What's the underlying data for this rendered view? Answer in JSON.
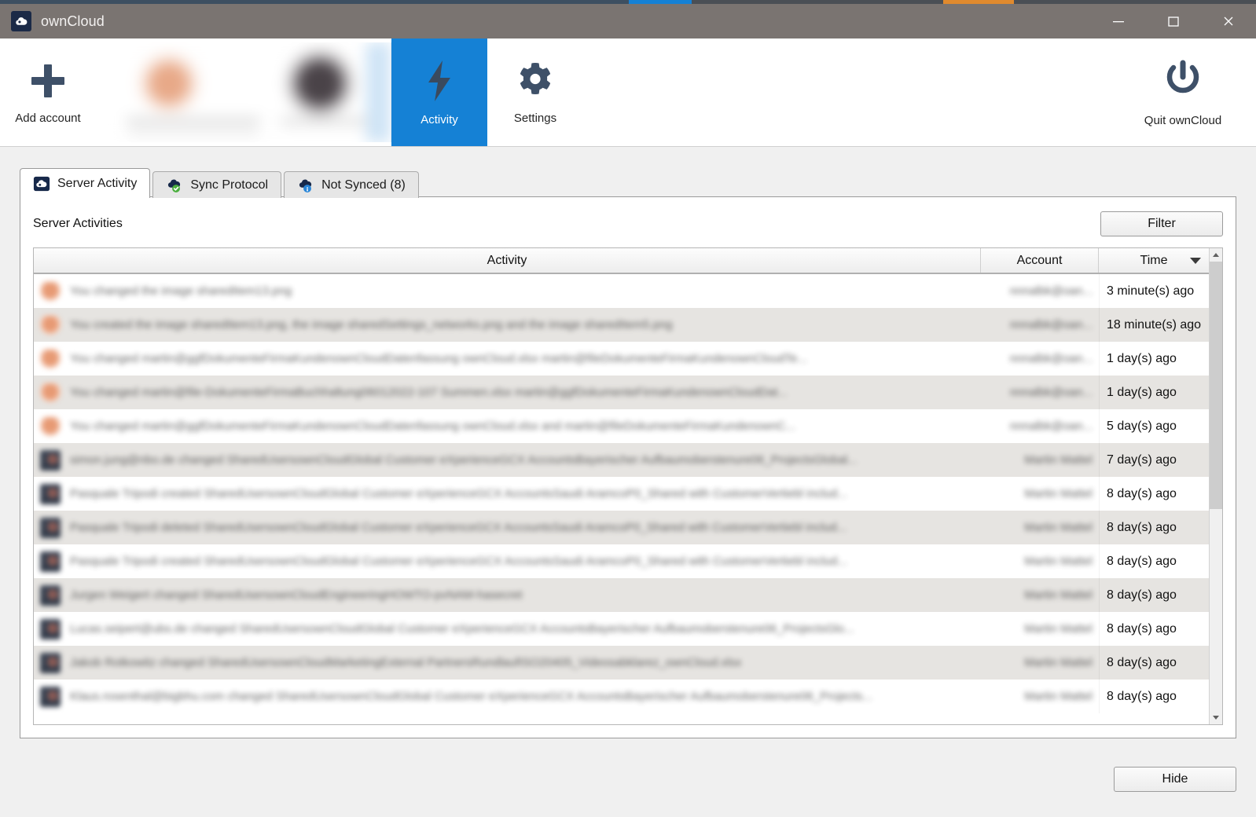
{
  "window": {
    "title": "ownCloud",
    "logo_icon": "owncloud-cloud-icon",
    "minimize_label": "Minimize",
    "maximize_label": "Maximize",
    "close_label": "Close"
  },
  "toolbar": {
    "add_account": {
      "label": "Add account",
      "icon": "plus-icon"
    },
    "accounts_strip": {
      "label": "",
      "redacted": true
    },
    "activity": {
      "label": "Activity",
      "icon": "lightning-bolt-icon",
      "active": true
    },
    "settings": {
      "label": "Settings",
      "icon": "gear-icon",
      "active": false
    },
    "quit": {
      "label": "Quit ownCloud",
      "icon": "power-icon"
    }
  },
  "tabs": [
    {
      "label": "Server Activity",
      "icon": "cloud-icon",
      "selected": true
    },
    {
      "label": "Sync Protocol",
      "icon": "cloud-check-icon",
      "selected": false
    },
    {
      "label": "Not Synced (8)",
      "icon": "cloud-info-icon",
      "selected": false
    }
  ],
  "panel": {
    "title": "Server Activities",
    "filter_button": "Filter"
  },
  "table": {
    "columns": [
      "Activity",
      "Account",
      "Time"
    ],
    "sort_column": "Time",
    "sort_icon": "sort-descending-caret",
    "rows": [
      {
        "icon": "activity-image-icon",
        "activity": "You changed the image sharedItem13.png",
        "account": "nnnalbk@oan...",
        "time": "3 minute(s) ago"
      },
      {
        "icon": "activity-image-icon",
        "activity": "You created the image sharedItem13.png, the image sharedSettings_networks.png and the image sharedItem5.png",
        "account": "nnnalbk@oan...",
        "time": "18 minute(s) ago"
      },
      {
        "icon": "activity-image-icon",
        "activity": "You changed martin@ggfDokumenteFirmaKundenownCloudDatenfassung ownCloud.xlsx martin@fileDokumenteFirmaKundenownCloudTe...",
        "account": "nnnalbk@oan...",
        "time": "1 day(s) ago"
      },
      {
        "icon": "activity-image-icon",
        "activity": "You changed martin@file-DokumenteFirmaBuchhaltung06012022-107 Summen.xlsx martin@ggfDokumenteFirmaKundenownCloudDat...",
        "account": "nnnalbk@oan...",
        "time": "1 day(s) ago"
      },
      {
        "icon": "activity-image-icon",
        "activity": "You changed martin@ggfDokumenteFirmaKundenownCloudDatenfassung ownCloud.xlsx and martin@fileDokumenteFirmaKundenownC...",
        "account": "nnnalbk@oan...",
        "time": "5 day(s) ago"
      },
      {
        "icon": "activity-folder-icon",
        "activity": "simon.jung@nbo.de changed SharedUsersownCloudGlobal Customer eXperienceGCX AccountsBayerischer Aufbaumoberstenure06_ProjectsGlobal...",
        "account": "Martin Mattel",
        "time": "7 day(s) ago"
      },
      {
        "icon": "activity-folder-icon",
        "activity": "Pasquale Tripodi created SharedUsersownCloudGlobal Customer eXperienceGCX AccountsSaudi AramcoP0_Shared with CustomerVertiebl includ...",
        "account": "Martin Mattel",
        "time": "8 day(s) ago"
      },
      {
        "icon": "activity-folder-icon",
        "activity": "Pasquale Tripodi deleted SharedUsersownCloudGlobal Customer eXperienceGCX AccountsSaudi AramcoP0_Shared with CustomerVertiebl includ...",
        "account": "Martin Mattel",
        "time": "8 day(s) ago"
      },
      {
        "icon": "activity-folder-icon",
        "activity": "Pasquale Tripodi created SharedUsersownCloudGlobal Customer eXperienceGCX AccountsSaudi AramcoP0_Shared with CustomerVertiebl includ...",
        "account": "Martin Mattel",
        "time": "8 day(s) ago"
      },
      {
        "icon": "activity-folder-icon",
        "activity": "Jurgen Weigert changed SharedUsersownCloudEngineeringHOWTO-pvNAM-hasecret",
        "account": "Martin Mattel",
        "time": "8 day(s) ago"
      },
      {
        "icon": "activity-folder-icon",
        "activity": "Lucas.seipert@ubs.de changed SharedUsersownCloudGlobal Customer eXperienceGCX AccountsBayerischer Aufbaumoberstenure06_ProjectsGlo...",
        "account": "Martin Mattel",
        "time": "8 day(s) ago"
      },
      {
        "icon": "activity-folder-icon",
        "activity": "Jakob Rotkowitz changed SharedUsersownCloudMarketingExternal PartnersRundlaufISO20405_Videosabklarez_ownCloud.xlsx",
        "account": "Martin Mattel",
        "time": "8 day(s) ago"
      },
      {
        "icon": "activity-folder-icon",
        "activity": "Klaus.rosenthal@bigbhu.com changed SharedUsersownCloudGlobal Customer eXperienceGCX AccountsBayerischer Aufbaumoberstenure06_Projects...",
        "account": "Martin Mattel",
        "time": "8 day(s) ago"
      }
    ]
  },
  "footer": {
    "hide_button": "Hide"
  },
  "colors": {
    "titlebar": "#7a7471",
    "accent_blue": "#1581d5",
    "icon_slate": "#3e5068",
    "row_alt": "#e6e4e1"
  }
}
